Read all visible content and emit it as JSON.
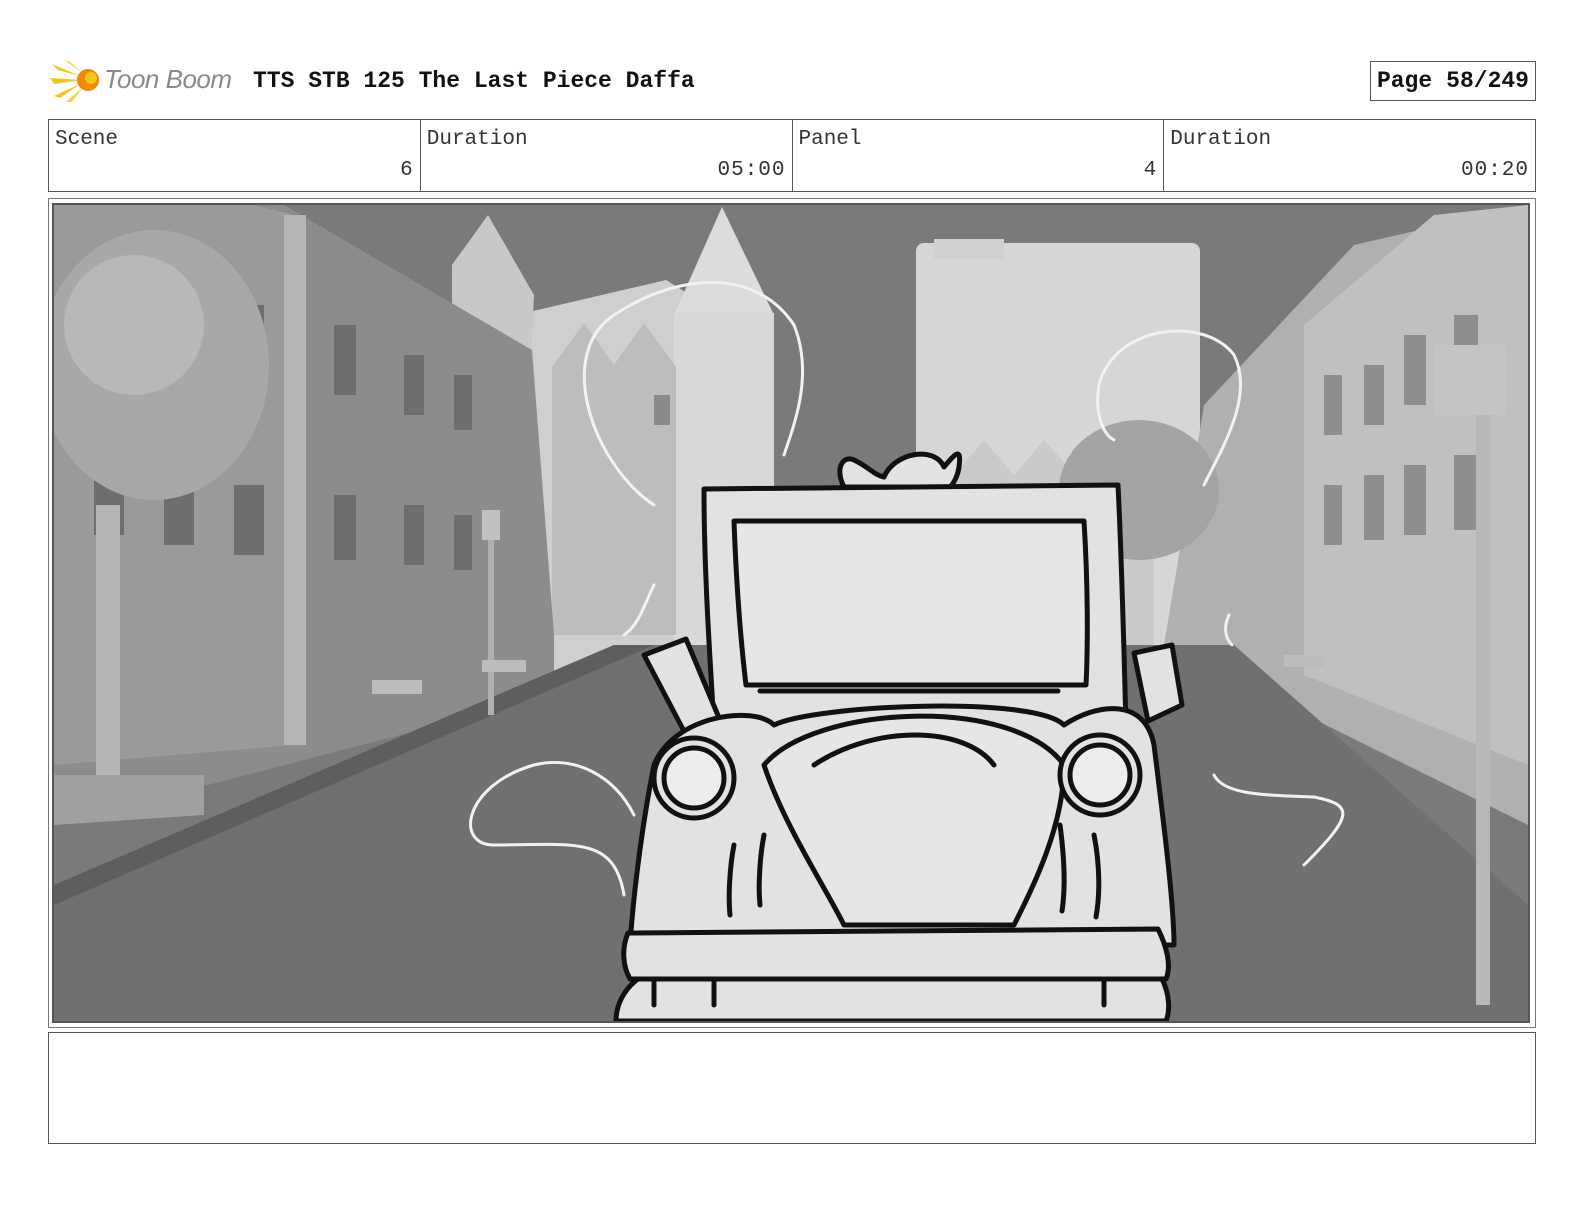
{
  "header": {
    "logo_text": "Toon Boom",
    "title": "TTS STB 125 The Last Piece Daffa",
    "page_label": "Page",
    "page_value": "58/249"
  },
  "info": {
    "scene_label": "Scene",
    "scene_value": "6",
    "scene_duration_label": "Duration",
    "scene_duration_value": "05:00",
    "panel_label": "Panel",
    "panel_value": "4",
    "panel_duration_label": "Duration",
    "panel_duration_value": "00:20"
  },
  "panel": {
    "image_name": "storyboard-panel-street-car"
  },
  "notes": {
    "text": ""
  },
  "colors": {
    "logo_yellow": "#f5c518",
    "logo_orange": "#f08a00",
    "sky": "#7a7a7a",
    "buildings_light": "#d4d4d4",
    "buildings_mid": "#9a9a9a",
    "street": "#707070",
    "sketch_fill": "#e2e2e2",
    "sketch_line": "#111111"
  }
}
